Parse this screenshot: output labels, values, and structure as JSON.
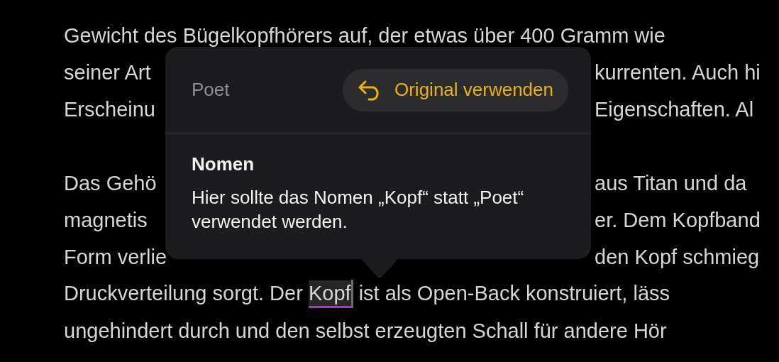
{
  "document": {
    "paragraphs": [
      {
        "lines": [
          {
            "kind": "full",
            "text": "Gewicht des Bügelkopfhörers auf, der etwas über 400 Gramm wie"
          },
          {
            "kind": "split",
            "left": "seiner Art",
            "right": "kurrenten. Auch hi"
          },
          {
            "kind": "split",
            "left": "Erscheinu",
            "right": "Eigenschaften. Al"
          }
        ]
      },
      {
        "lines": [
          {
            "kind": "split",
            "left": "Das Gehö",
            "right": "aus Titan und da"
          },
          {
            "kind": "split",
            "left": "magnetis",
            "right": "er. Dem Kopfband"
          },
          {
            "kind": "split",
            "left": "Form verlie",
            "right": "den Kopf schmieg"
          },
          {
            "kind": "flagged",
            "before": "Druckverteilung sorgt. Der ",
            "word": "Kopf",
            "after": " ist als Open-Back konstruiert, läss"
          },
          {
            "kind": "full",
            "text": "ungehindert durch und den selbst erzeugten Schall für andere Hör"
          }
        ]
      }
    ]
  },
  "popover": {
    "label": "Poet",
    "action": "Original verwenden",
    "heading": "Nomen",
    "message": "Hier sollte das Nomen „Kopf“ statt „Poet“ verwendet werden."
  }
}
